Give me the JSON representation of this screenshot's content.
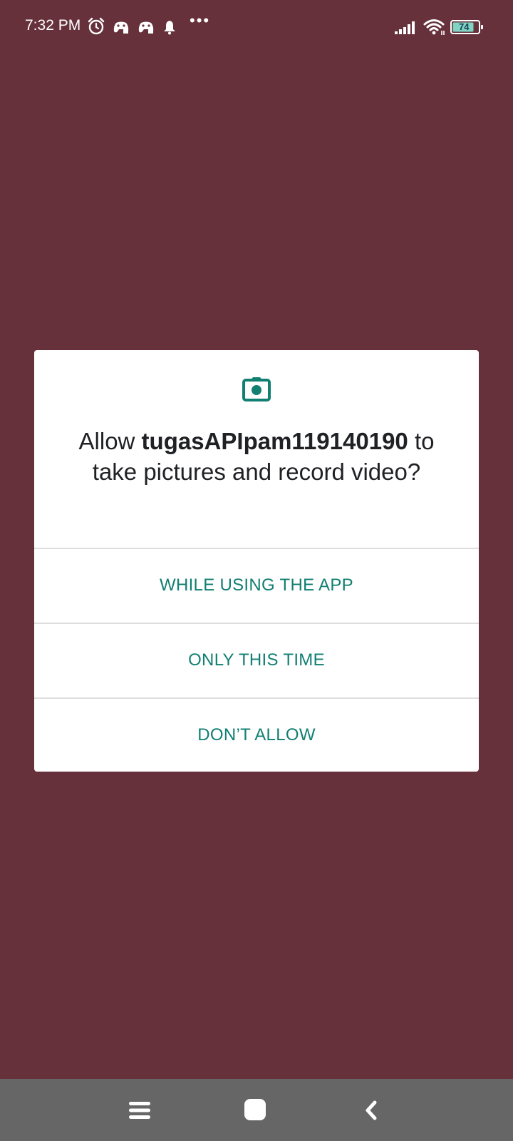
{
  "status_bar": {
    "time": "7:32 PM",
    "icons": [
      "alarm-icon",
      "game-controller-icon",
      "game-controller-icon",
      "notification-bell-icon",
      "more-dots-icon",
      "signal-icon",
      "wifi-icon",
      "battery-icon"
    ],
    "more": "•••",
    "battery_level": "74",
    "colors": {
      "text": "#ffffff",
      "battery_fill": "#7fd3c0"
    }
  },
  "background_color": "#66313b",
  "dialog": {
    "icon": "camera-icon",
    "message_prefix": "Allow ",
    "app_name": "tugasAPIpam119140190",
    "message_suffix": " to take pictures and record video?",
    "buttons": {
      "while_using": "WHILE USING THE APP",
      "only_this_time": "ONLY THIS TIME",
      "dont_allow": "DON’T ALLOW"
    },
    "colors": {
      "accent": "#117f72",
      "text": "#202124",
      "divider": "#dedede"
    }
  },
  "nav_bar": {
    "icons": [
      "menu-icon",
      "home-icon",
      "back-icon"
    ],
    "color": "#666666"
  }
}
